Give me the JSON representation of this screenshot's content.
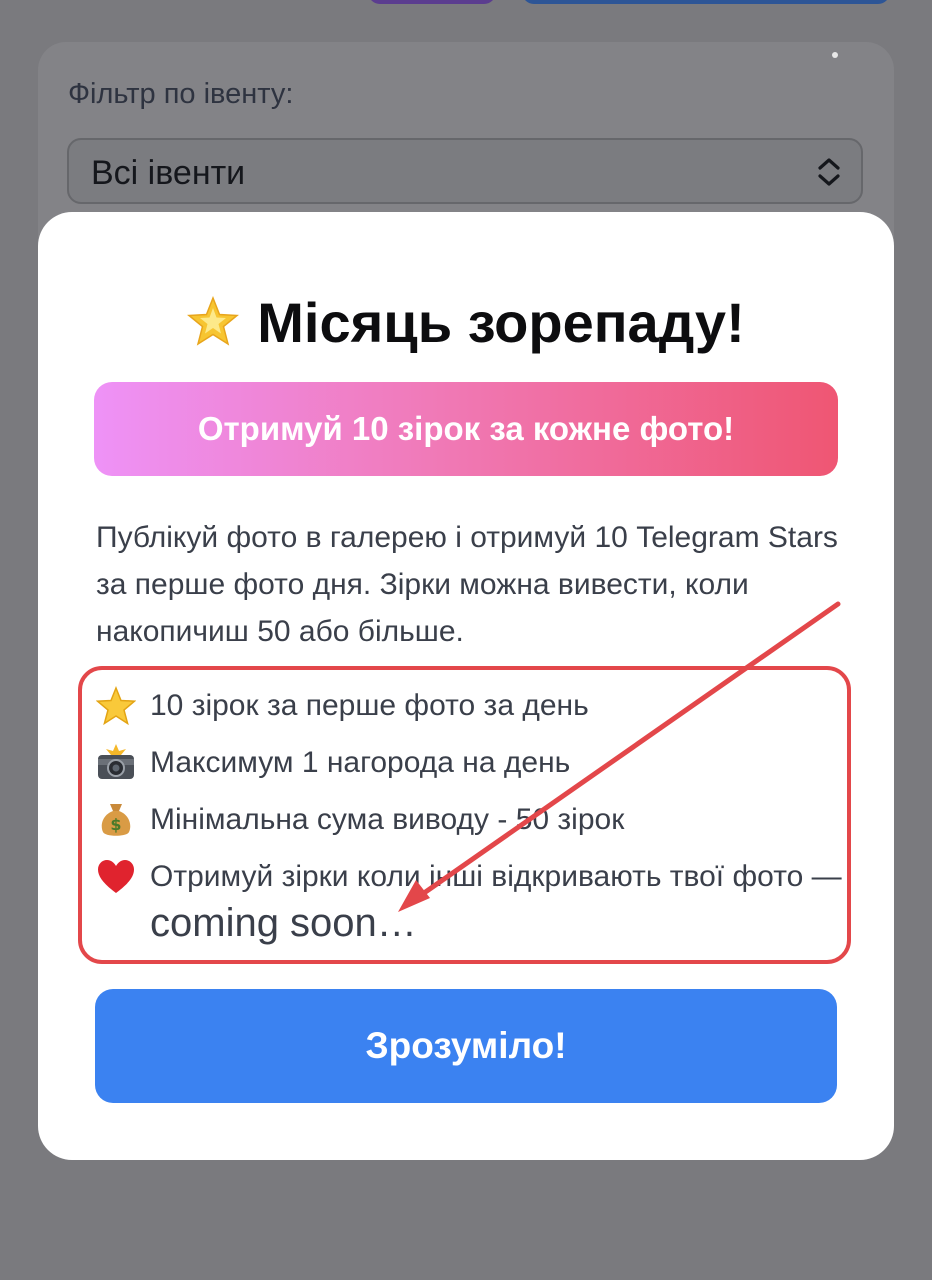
{
  "background": {
    "filter": {
      "label": "Фільтр по івенту:",
      "selected_value": "Всі івенти"
    }
  },
  "modal": {
    "title": "Місяць зорепаду!",
    "title_icon": "glowing-star-icon",
    "banner_text": "Отримуй 10 зірок за кожне фото!",
    "description": "Публікуй фото в галерею і отримуй 10 Telegram Stars за перше фото дня. Зірки можна вивести, коли накопичиш 50 або більше.",
    "features": [
      {
        "icon": "star-icon",
        "text": "10 зірок за перше фото за день"
      },
      {
        "icon": "camera-flash-icon",
        "text": "Максимум 1 нагорода на день"
      },
      {
        "icon": "money-bag-icon",
        "text": "Мінімальна сума виводу - 50 зірок"
      },
      {
        "icon": "red-heart-icon",
        "text": "Отримуй зірки коли інші відкривають твої фото —",
        "suffix": "coming soon…"
      }
    ],
    "confirm_button": "Зрозуміло!"
  },
  "colors": {
    "overlay": "#7a7a7e",
    "banner_gradient": [
      "#ee92f7",
      "#ef5673"
    ],
    "button": "#3b82f1",
    "annotation": "#e3474a"
  }
}
